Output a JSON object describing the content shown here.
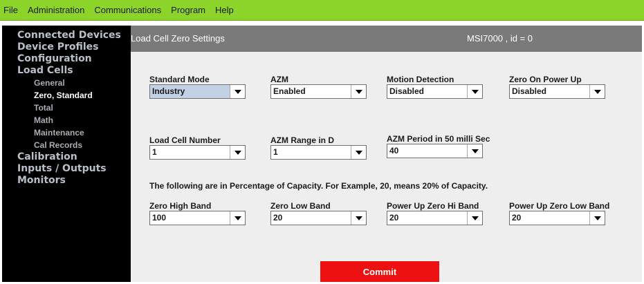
{
  "menu": [
    "File",
    "Administration",
    "Communications",
    "Program",
    "Help"
  ],
  "sidebar": [
    {
      "label": "Connected Devices",
      "level": 0
    },
    {
      "label": "Device Profiles",
      "level": 0
    },
    {
      "label": "Configuration",
      "level": 0
    },
    {
      "label": "Load Cells",
      "level": 0
    },
    {
      "label": "General",
      "level": 1
    },
    {
      "label": "Zero, Standard",
      "level": 1,
      "active": true
    },
    {
      "label": "Total",
      "level": 1
    },
    {
      "label": "Math",
      "level": 1
    },
    {
      "label": "Maintenance",
      "level": 1
    },
    {
      "label": "Cal Records",
      "level": 1
    },
    {
      "label": "Calibration",
      "level": 0
    },
    {
      "label": "Inputs / Outputs",
      "level": 0
    },
    {
      "label": "Monitors",
      "level": 0
    }
  ],
  "header": {
    "title": "Load Cell Zero Settings",
    "device": "MSI7000 , id = 0"
  },
  "fields": {
    "standard_mode": {
      "label": "Standard Mode",
      "value": "Industry"
    },
    "azm": {
      "label": "AZM",
      "value": "Enabled"
    },
    "motion_detection": {
      "label": "Motion Detection",
      "value": "Disabled"
    },
    "zero_on_power_up": {
      "label": "Zero On Power Up",
      "value": "Disabled"
    },
    "load_cell_number": {
      "label": "Load Cell Number",
      "value": "1"
    },
    "azm_range": {
      "label": "AZM Range in D",
      "value": "1"
    },
    "azm_period": {
      "label": "AZM Period in 50 milli Sec",
      "value": "40"
    },
    "zero_high_band": {
      "label": "Zero High Band",
      "value": "100"
    },
    "zero_low_band": {
      "label": "Zero Low Band",
      "value": "20"
    },
    "power_up_zero_hi_band": {
      "label": "Power Up Zero Hi Band",
      "value": "20"
    },
    "power_up_zero_low_band": {
      "label": "Power Up Zero Low Band",
      "value": "20"
    }
  },
  "info_text": "The following are in Percentage of Capacity. For Example, 20, means 20% of Capacity.",
  "commit_label": "Commit",
  "colors": {
    "menubar": "#8cd42a",
    "sidebar": "#000000",
    "header": "#7a7a7a",
    "panel": "#eeeeee",
    "commit": "#ee1111",
    "selected_value": "#c3d1e6"
  },
  "icons": {
    "dropdown": "triangle-down-icon"
  }
}
